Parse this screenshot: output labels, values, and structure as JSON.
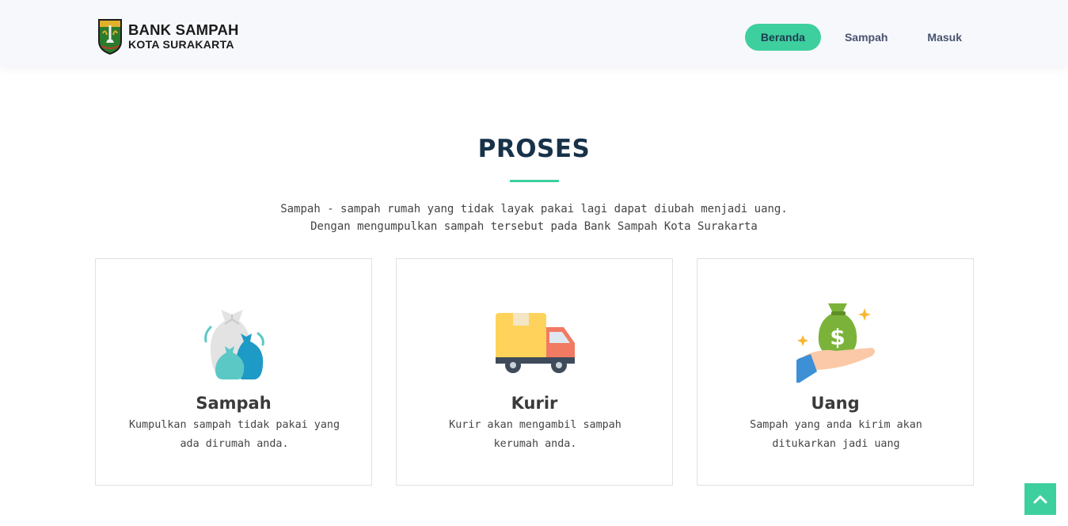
{
  "header": {
    "logo_line1": "BANK SAMPAH",
    "logo_line2": "KOTA SURAKARTA",
    "nav": [
      {
        "label": "Beranda",
        "active": true
      },
      {
        "label": "Sampah",
        "active": false
      },
      {
        "label": "Masuk",
        "active": false
      }
    ]
  },
  "main": {
    "title": "PROSES",
    "lead_line1": "Sampah - sampah rumah yang tidak layak pakai lagi dapat diubah menjadi uang.",
    "lead_line2": "Dengan mengumpulkan sampah tersebut pada Bank Sampah Kota Surakarta",
    "cards": [
      {
        "icon": "garbage-bags-icon",
        "title": "Sampah",
        "desc_line1": "Kumpulkan sampah tidak pakai yang",
        "desc_line2": "ada dirumah anda."
      },
      {
        "icon": "delivery-truck-icon",
        "title": "Kurir",
        "desc_line1": "Kurir akan mengambil sampah",
        "desc_line2": "kerumah anda."
      },
      {
        "icon": "money-bag-hand-icon",
        "title": "Uang",
        "desc_line1": "Sampah yang anda kirim akan",
        "desc_line2": "ditukarkan jadi uang"
      }
    ]
  },
  "colors": {
    "accent": "#3ecf9e",
    "title": "#173249",
    "header_bg": "#f7f8fc"
  },
  "back_to_top": {
    "icon": "chevron-up-icon"
  }
}
